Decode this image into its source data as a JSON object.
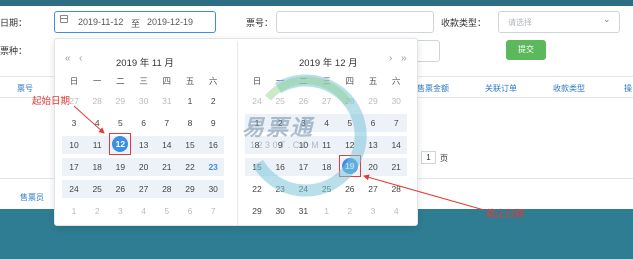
{
  "form": {
    "date_label": "日期：",
    "start_date": "2019-11-12",
    "to_label": "至",
    "end_date": "2019-12-19",
    "ticket_no_label": "票号：",
    "payment_type_label": "收款类型：",
    "payment_type_placeholder": "请选择",
    "ticket_type_label": "票种：",
    "submit_label": "提交"
  },
  "table": {
    "headers": [
      "票号",
      "售票金额",
      "关联订单",
      "收款类型",
      "操"
    ],
    "page_number": "1",
    "page_label": "页",
    "seller_label": "售票员"
  },
  "calendar_left": {
    "title": "2019 年 11 月",
    "weekdays": [
      "日",
      "一",
      "二",
      "三",
      "四",
      "五",
      "六"
    ],
    "weeks": [
      [
        "27",
        "28",
        "29",
        "30",
        "31",
        "1",
        "2"
      ],
      [
        "3",
        "4",
        "5",
        "6",
        "7",
        "8",
        "9"
      ],
      [
        "10",
        "11",
        "12",
        "13",
        "14",
        "15",
        "16"
      ],
      [
        "17",
        "18",
        "19",
        "20",
        "21",
        "22",
        "23"
      ],
      [
        "24",
        "25",
        "26",
        "27",
        "28",
        "29",
        "30"
      ],
      [
        "1",
        "2",
        "3",
        "4",
        "5",
        "6",
        "7"
      ]
    ]
  },
  "calendar_right": {
    "title": "2019 年 12 月",
    "weekdays": [
      "日",
      "一",
      "二",
      "三",
      "四",
      "五",
      "六"
    ],
    "weeks": [
      [
        "24",
        "25",
        "26",
        "27",
        "28",
        "29",
        "30"
      ],
      [
        "1",
        "2",
        "3",
        "4",
        "5",
        "6",
        "7"
      ],
      [
        "8",
        "9",
        "10",
        "11",
        "12",
        "13",
        "14"
      ],
      [
        "15",
        "16",
        "17",
        "18",
        "19",
        "20",
        "21"
      ],
      [
        "22",
        "23",
        "24",
        "25",
        "26",
        "27",
        "28"
      ],
      [
        "29",
        "30",
        "31",
        "1",
        "2",
        "3",
        "4"
      ]
    ]
  },
  "annotations": {
    "start": "起始日期",
    "end": "截止日期"
  },
  "watermark": {
    "text": "易票通",
    "sub": "1 2 3 0 T . C O M"
  },
  "colors": {
    "accent": "#3d8ee6",
    "submit": "#5cb85c",
    "annotation": "#e53935",
    "band": "#2e7d93"
  }
}
